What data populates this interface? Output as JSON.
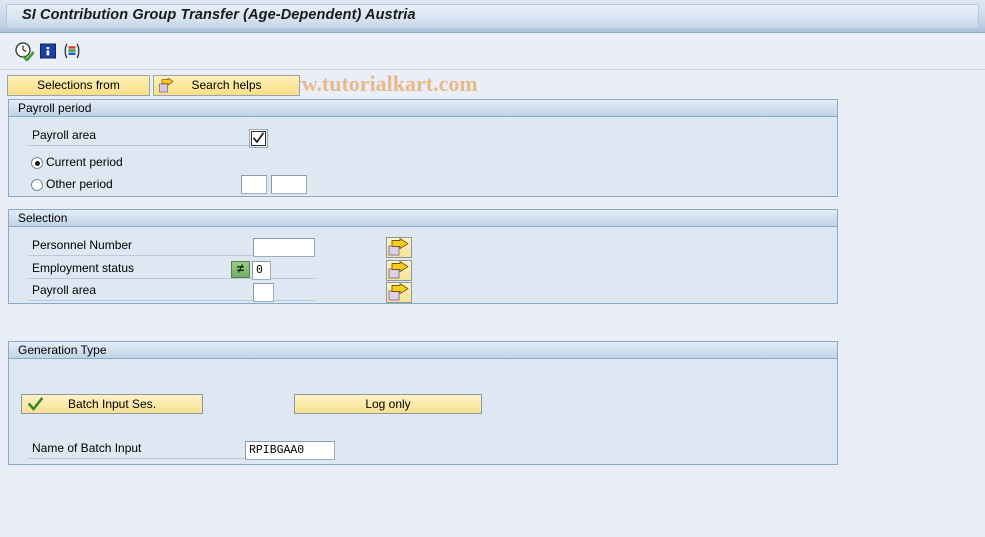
{
  "window": {
    "title": "SI Contribution Group Transfer (Age-Dependent) Austria"
  },
  "watermark": {
    "text": "© www.tutorialkart.com",
    "color": "#e8b98a"
  },
  "toolbar": {
    "icons": [
      {
        "name": "execute-clock-icon",
        "title": "Execute"
      },
      {
        "name": "information-icon",
        "title": "Information"
      },
      {
        "name": "variant-list-icon",
        "title": "Get Variant"
      }
    ]
  },
  "tabs": [
    {
      "label": "Selections from",
      "icon": "none"
    },
    {
      "label": "Search helps",
      "icon": "yellow-arrow-icon"
    }
  ],
  "panels": {
    "payroll_period": {
      "title": "Payroll period",
      "payroll_area": {
        "label": "Payroll area",
        "checkbox_icon": "checkbox-checked-icon",
        "checked": true
      },
      "period_options": [
        {
          "label": "Current period",
          "selected": true
        },
        {
          "label": "Other period",
          "selected": false
        }
      ],
      "other_period_fields": [
        {
          "name": "other-period-value-1",
          "value": ""
        },
        {
          "name": "other-period-value-2",
          "value": ""
        }
      ]
    },
    "selection": {
      "title": "Selection",
      "rows": [
        {
          "label": "Personnel Number",
          "value": "",
          "operator": "",
          "has_operator": false,
          "multi_select_icon": "multiple-selection-arrow-icon"
        },
        {
          "label": "Employment status",
          "value": "0",
          "operator": "≠",
          "has_operator": true,
          "multi_select_icon": "multiple-selection-arrow-icon"
        },
        {
          "label": "Payroll area",
          "value": "",
          "operator": "",
          "has_operator": false,
          "multi_select_icon": "multiple-selection-arrow-icon"
        }
      ]
    },
    "generation_type": {
      "title": "Generation Type",
      "batch_button": {
        "label": "Batch Input Ses.",
        "icon": "green-check-icon",
        "selected": true
      },
      "log_button": {
        "label": "Log only",
        "selected": false
      },
      "batch_name": {
        "label": "Name of Batch Input",
        "value": "RPIBGAA0"
      }
    }
  },
  "theme": {
    "background": "#eaeff7",
    "panel_background": "#dde8f2",
    "panel_border": "#8aa8c8",
    "button_yellow": "#fbe79b",
    "accent_green": "#74ad63"
  }
}
